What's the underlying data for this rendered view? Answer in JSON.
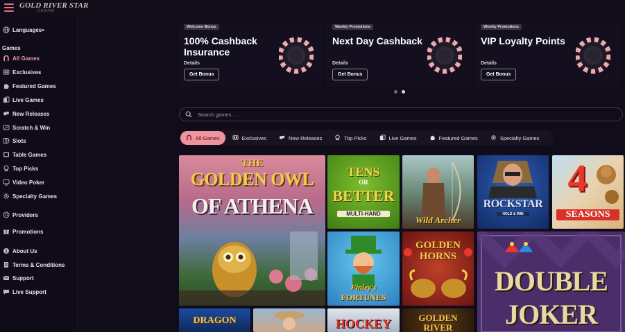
{
  "header": {
    "logo": "GOLD RIVER STAR",
    "logo_sub": "CASINO"
  },
  "sidebar": {
    "languages": "Languages",
    "games_header": "Games",
    "items": [
      {
        "label": "All Games",
        "icon": "horseshoe-icon"
      },
      {
        "label": "Exclusives",
        "icon": "exclusive-icon"
      },
      {
        "label": "Featured Games",
        "icon": "puzzle-icon"
      },
      {
        "label": "Live Games",
        "icon": "cards-icon"
      },
      {
        "label": "New Releases",
        "icon": "new-icon"
      },
      {
        "label": "Scratch & Win",
        "icon": "scratch-icon"
      },
      {
        "label": "Slots",
        "icon": "slot-icon"
      },
      {
        "label": "Table Games",
        "icon": "table-icon"
      },
      {
        "label": "Top Picks",
        "icon": "trophy-icon"
      },
      {
        "label": "Video Poker",
        "icon": "video-poker-icon"
      },
      {
        "label": "Specialty Games",
        "icon": "gear-icon"
      }
    ],
    "providers": "Providers",
    "promotions": "Promotions",
    "about": "About Us",
    "terms": "Terms & Conditions",
    "support": "Support",
    "live_support": "Live Support"
  },
  "promos": [
    {
      "tag": "Welcome Bonus",
      "title": "100% Cashback Insurance",
      "details": "Details",
      "button": "Get Bonus"
    },
    {
      "tag": "Weekly Promotions",
      "title": "Next Day Cashback",
      "details": "Details",
      "button": "Get Bonus"
    },
    {
      "tag": "Weekly Promotions",
      "title": "VIP Loyalty Points",
      "details": "Details",
      "button": "Get Bonus"
    }
  ],
  "search": {
    "placeholder": "Search games . . ."
  },
  "tabs": [
    {
      "label": "All Games",
      "icon": "horseshoe-icon"
    },
    {
      "label": "Exclusives",
      "icon": "exclusive-icon"
    },
    {
      "label": "New Releases",
      "icon": "new-icon"
    },
    {
      "label": "Top Picks",
      "icon": "trophy-icon"
    },
    {
      "label": "Live Games",
      "icon": "cards-icon"
    },
    {
      "label": "Featured Games",
      "icon": "puzzle-icon"
    },
    {
      "label": "Specialty Games",
      "icon": "gear-icon"
    }
  ],
  "games": {
    "golden_owl": {
      "l1": "THE",
      "l2": "GOLDEN OWL",
      "l3": "OF ATHENA"
    },
    "tens": {
      "l1": "TENS",
      "l2": "OR",
      "l3": "BETTER",
      "l4": "MULTI-HAND"
    },
    "wild_archer": "Wild Archer",
    "rockstar": {
      "l1": "ROCKSTAR",
      "l2": "HOLD & WIN"
    },
    "four_seasons": {
      "l1": "4",
      "l2": "SEASONS"
    },
    "finleys": {
      "l1": "Finley's",
      "l2": "FORTUNES"
    },
    "golden_horns": {
      "l1": "GOLDEN",
      "l2": "HORNS"
    },
    "double_joker": {
      "l1": "DOUBLE",
      "l2": "JOKER"
    },
    "dragon": "DRAGON",
    "hockey": "HOCKEY",
    "golden_river": {
      "l1": "GOLDEN",
      "l2": "RIVER"
    }
  },
  "colors": {
    "accent": "#f0939c",
    "bg": "#100c1a"
  }
}
